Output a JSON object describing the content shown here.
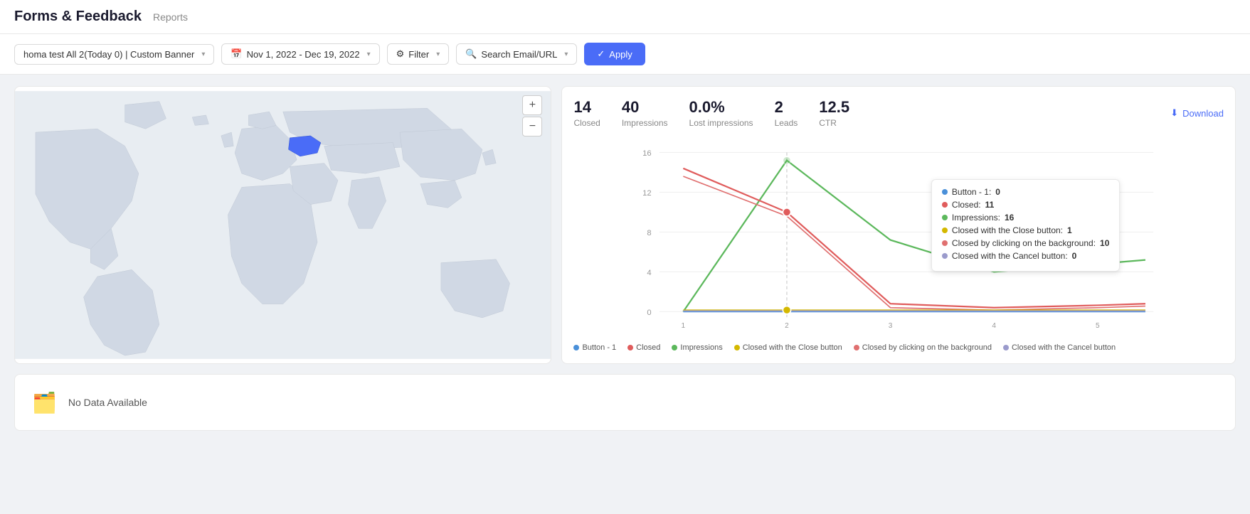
{
  "header": {
    "title": "Forms & Feedback",
    "breadcrumb": "Reports"
  },
  "toolbar": {
    "segment_label": "homa test All 2(Today 0) | Custom Banner",
    "date_range": "Nov 1, 2022 - Dec 19, 2022",
    "filter_label": "Filter",
    "search_label": "Search Email/URL",
    "apply_label": "Apply"
  },
  "stats": {
    "closed_value": "14",
    "closed_label": "Closed",
    "impressions_value": "40",
    "impressions_label": "Impressions",
    "lost_impressions_value": "0.0%",
    "lost_impressions_label": "Lost impressions",
    "leads_value": "2",
    "leads_label": "Leads",
    "ctr_value": "12.5",
    "ctr_label": "CTR",
    "download_label": "Download"
  },
  "tooltip": {
    "button_label": "Button - 1:",
    "button_value": "0",
    "closed_label": "Closed:",
    "closed_value": "11",
    "impressions_label": "Impressions:",
    "impressions_value": "16",
    "closed_close_label": "Closed with the Close button:",
    "closed_close_value": "1",
    "closed_bg_label": "Closed by clicking on the background:",
    "closed_bg_value": "10",
    "closed_cancel_label": "Closed with the Cancel button:",
    "closed_cancel_value": "0"
  },
  "legend": {
    "items": [
      {
        "label": "Button - 1",
        "color": "#4a90d9"
      },
      {
        "label": "Closed",
        "color": "#e05c5c"
      },
      {
        "label": "Impressions",
        "color": "#5cb85c"
      },
      {
        "label": "Closed with the Close button",
        "color": "#d4b800"
      },
      {
        "label": "Closed by clicking on the background",
        "color": "#e07070"
      },
      {
        "label": "Closed with the Cancel button",
        "color": "#9b9bcc"
      }
    ]
  },
  "bottom": {
    "no_data_text": "No Data Available",
    "icon": "🗂️"
  },
  "colors": {
    "blue": "#4a6cf7",
    "green": "#5cb85c",
    "red": "#e05c5c",
    "yellow": "#d4b800",
    "light_red": "#e07070",
    "purple": "#9b9bcc",
    "light_blue": "#4a90d9"
  }
}
